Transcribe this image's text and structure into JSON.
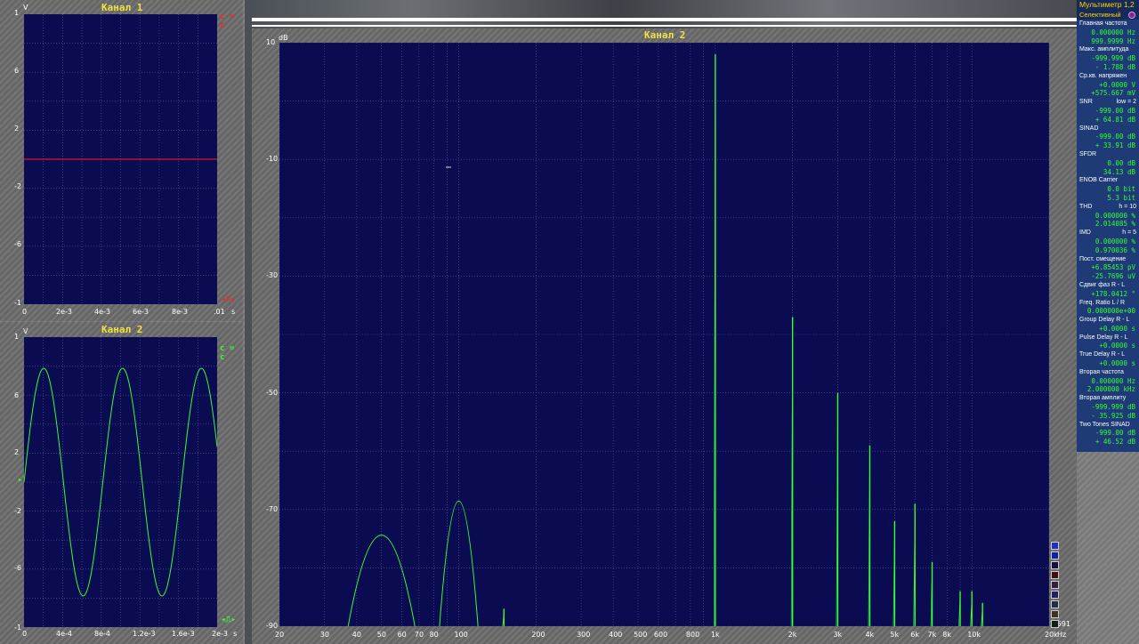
{
  "ch1": {
    "title": "Канал 1",
    "unit_y": "V",
    "unit_x": "s",
    "marker": "c = c",
    "y_ticks": [
      "1",
      "6",
      "2",
      "-2",
      "-6",
      "-1"
    ],
    "x_ticks": [
      "0",
      "2e-3",
      "4e-3",
      "6e-3",
      "8e-3",
      ".01"
    ]
  },
  "ch2_small": {
    "title": "Канал 2",
    "unit_y": "V",
    "unit_x": "s",
    "marker": "c = c",
    "y_ticks": [
      "1",
      "6",
      "2",
      "-2",
      "-6",
      "-1"
    ],
    "x_ticks": [
      "0",
      "4e-4",
      "8e-4",
      "1.2e-3",
      "1.6e-3",
      "2e-3"
    ]
  },
  "spectrum": {
    "title": "Канал 2",
    "unit_y": "dB",
    "unit_x": "Hz",
    "y_ticks": [
      "10",
      "-10",
      "-30",
      "-50",
      "-70",
      "-90"
    ],
    "x_ticks": [
      "20",
      "30",
      "40",
      "50",
      "60",
      "70",
      "80",
      "100",
      "200",
      "300",
      "400",
      "500",
      "600",
      "800",
      "1k",
      "2k",
      "3k",
      "4k",
      "5k",
      "6k",
      "7k",
      "8k",
      "10k",
      "20k"
    ],
    "corner_value": "2.691"
  },
  "chart_data": {
    "type": "line",
    "title": "Канал 2",
    "xlabel": "Hz",
    "ylabel": "dB",
    "x_scale": "log",
    "xlim": [
      20,
      20000
    ],
    "ylim": [
      -90,
      10
    ],
    "grid": true,
    "series": [
      {
        "peaks": [
          {
            "x": 50,
            "y": -74
          },
          {
            "x": 100,
            "y": -68
          },
          {
            "x": 150,
            "y": -87
          },
          {
            "x": 1000,
            "y": 8
          },
          {
            "x": 2000,
            "y": -37
          },
          {
            "x": 3000,
            "y": -50
          },
          {
            "x": 4000,
            "y": -59
          },
          {
            "x": 5000,
            "y": -72
          },
          {
            "x": 6000,
            "y": -69
          },
          {
            "x": 7000,
            "y": -79
          },
          {
            "x": 9000,
            "y": -84
          },
          {
            "x": 10000,
            "y": -84
          },
          {
            "x": 11000,
            "y": -86
          }
        ]
      }
    ]
  },
  "multimeter": {
    "title": "Мультиметр 1,2",
    "mode": "Селективный",
    "rows": [
      {
        "head": "Главная частота",
        "right": "",
        "vals": [
          "0.000000  Hz",
          "999.9999  Hz"
        ]
      },
      {
        "head": "Макс. амплитуда",
        "right": "",
        "vals": [
          "-999.999 dB",
          "- 1.788 dB"
        ]
      },
      {
        "head": "Ср.кв. напряжен",
        "right": "",
        "vals": [
          "+0.0000  V",
          "+575.667 mV"
        ]
      },
      {
        "head": "SNR",
        "right": "low =  2",
        "vals": [
          "-999.00 dB",
          "+ 64.81 dB"
        ]
      },
      {
        "head": "SINAD",
        "right": "",
        "vals": [
          "-999.00 dB",
          "+ 33.91 dB"
        ]
      },
      {
        "head": "SFDR",
        "right": "",
        "vals": [
          "0.00 dB",
          "34.13 dB"
        ]
      },
      {
        "head": "ENOB  Carrier",
        "right": "",
        "vals": [
          "0.0 bit",
          "5.3 bit"
        ]
      },
      {
        "head": "THD",
        "right": "h =  10",
        "vals": [
          "0.000000 %",
          "2.014085 %"
        ]
      },
      {
        "head": "IMD",
        "right": "h =  5",
        "vals": [
          "0.000000 %",
          "0.970036 %"
        ]
      },
      {
        "head": "Пост. смещение",
        "right": "",
        "vals": [
          "+6.85453 pV",
          "-25.7696 uV"
        ]
      },
      {
        "head": "Сдвиг фаз R - L",
        "right": "",
        "vals": [
          "+178.0412 °"
        ]
      },
      {
        "head": "Freq. Ratio  L / R",
        "right": "",
        "vals": [
          "0.000000e+00"
        ]
      },
      {
        "head": "Group Delay R - L",
        "right": "",
        "vals": [
          "+0.0000  s"
        ]
      },
      {
        "head": "Pulse Delay R - L",
        "right": "",
        "vals": [
          "+0.0000  s"
        ]
      },
      {
        "head": "True Delay R - L",
        "right": "",
        "vals": [
          "+0.0000  s"
        ]
      },
      {
        "head": "Вторая частота",
        "right": "",
        "vals": [
          "0.000000  Hz",
          "2.000000 kHz"
        ]
      },
      {
        "head": "Вторая амплиту",
        "right": "",
        "vals": [
          "-999.999 dB",
          "- 35.925 dB"
        ]
      },
      {
        "head": "Two Tones SINAD",
        "right": "",
        "vals": [
          "-999.00 dB",
          "+ 46.52 dB"
        ]
      }
    ]
  },
  "colors": {
    "plot_bg": "#0b0b52",
    "trace": "#33ff33",
    "ch1_trace": "#ff2020",
    "title": "#f0e040",
    "mm_value": "#33ff33"
  }
}
